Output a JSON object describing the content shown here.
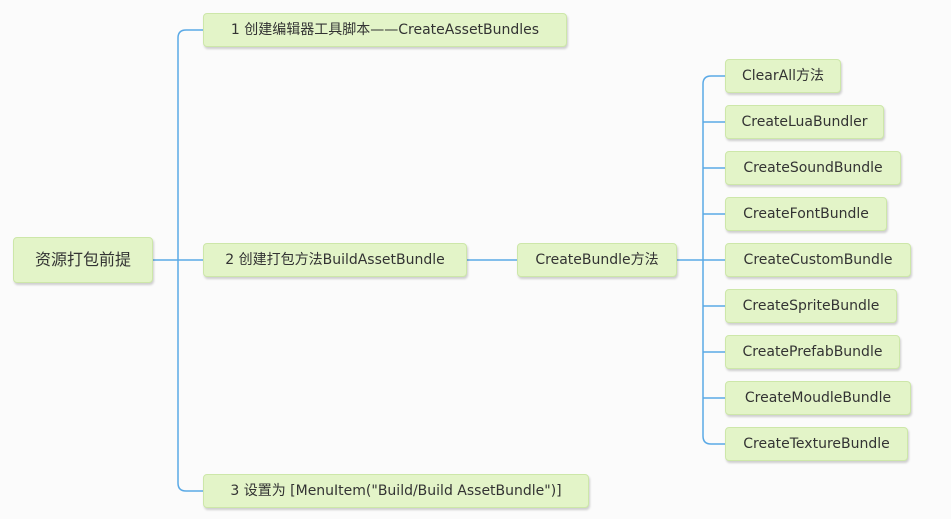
{
  "colors": {
    "line": "#5aa9e6",
    "node_fill": "#e3f4c8",
    "node_border": "#cde7a9",
    "text": "#333333"
  },
  "mindmap": {
    "root": "资源打包前提",
    "branches": [
      {
        "label": "1 创建编辑器工具脚本——CreateAssetBundles"
      },
      {
        "label": "2 创建打包方法BuildAssetBundle"
      },
      {
        "label": "3 设置为 [MenuItem(\"Build/Build AssetBundle\")]"
      }
    ],
    "method": {
      "label": "CreateBundle方法",
      "children": [
        "ClearAll方法",
        "CreateLuaBundler",
        "CreateSoundBundle",
        "CreateFontBundle",
        "CreateCustomBundle",
        "CreateSpriteBundle",
        "CreatePrefabBundle",
        "CreateMoudleBundle",
        "CreateTextureBundle"
      ]
    }
  }
}
